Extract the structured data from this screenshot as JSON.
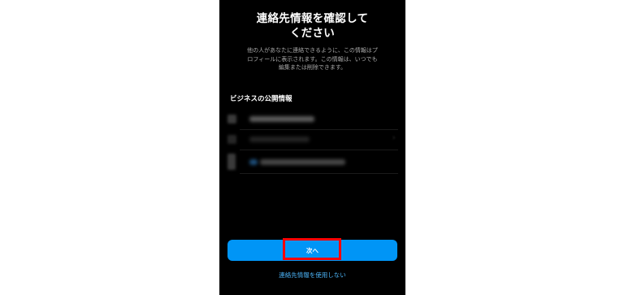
{
  "header": {
    "title_line1": "連絡先情報を確認して",
    "title_line2": "ください"
  },
  "description": {
    "line1": "他の人があなたに連絡できるように、この情報はプ",
    "line2": "ロフィールに表示されます。この情報は、いつでも",
    "line3": "編集または削除できます。"
  },
  "section": {
    "title": "ビジネスの公開情報"
  },
  "fields": [
    {
      "icon": "email-icon",
      "value": "(blurred email)"
    },
    {
      "icon": "location-icon",
      "value": "(blurred address)"
    },
    {
      "icon": "phone-icon",
      "value": "JP +81 (blurred phone number)"
    }
  ],
  "actions": {
    "next_label": "次へ",
    "skip_label": "連絡先情報を使用しない"
  },
  "colors": {
    "background": "#000000",
    "primary": "#0095f6",
    "link": "#4cb5f9",
    "highlight": "#ff0000"
  }
}
